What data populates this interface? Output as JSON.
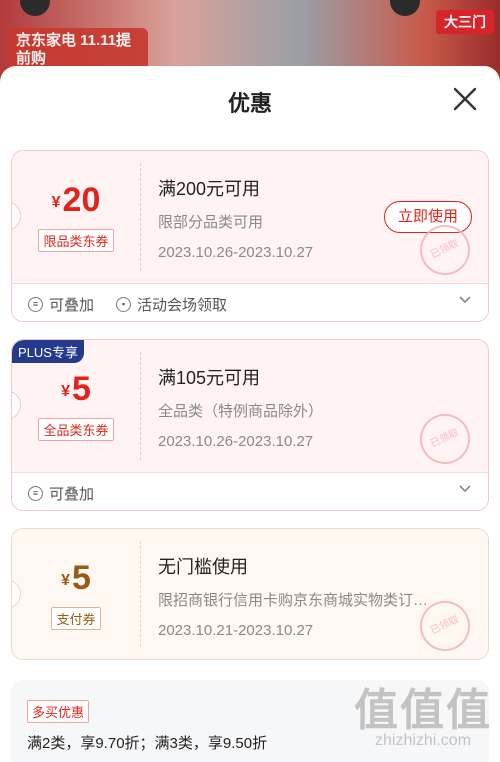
{
  "background": {
    "banner_text": "京东家电 11.11提前购",
    "badge_text": "大三门"
  },
  "sheet": {
    "title": "优惠"
  },
  "coupons": [
    {
      "currency": "¥",
      "amount": "20",
      "type_tag": "限品类东券",
      "condition": "满200元可用",
      "scope": "限部分品类可用",
      "date_range": "2023.10.26-2023.10.27",
      "action_label": "立即使用",
      "stamp": "已领取",
      "features": [
        "可叠加",
        "活动会场领取"
      ]
    },
    {
      "badge": "PLUS专享",
      "currency": "¥",
      "amount": "5",
      "type_tag": "全品类东券",
      "condition": "满105元可用",
      "scope": "全品类（特例商品除外）",
      "date_range": "2023.10.26-2023.10.27",
      "stamp": "已领取",
      "features": [
        "可叠加"
      ]
    },
    {
      "currency": "¥",
      "amount": "5",
      "type_tag": "支付券",
      "condition": "无门槛使用",
      "scope": "限招商银行信用卡购京东商城实物类订…",
      "date_range": "2023.10.21-2023.10.27",
      "stamp": "已领取"
    }
  ],
  "promo": {
    "tag": "多买优惠",
    "text": "满2类，享9.70折；满3类，享9.50折"
  },
  "watermark": {
    "big": "值值值",
    "small": "zhizhizhi.com"
  },
  "colors": {
    "accent": "#e2231a",
    "plus": "#243a8c",
    "payment": "#9a5a17"
  }
}
